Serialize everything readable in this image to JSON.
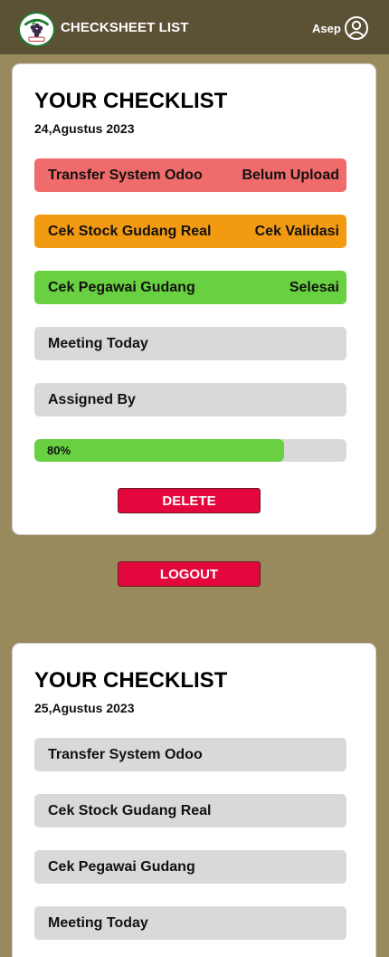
{
  "header": {
    "title": "CHECKSHEET LIST",
    "user_name": "Asep",
    "logo_icon": "grape-logo-icon",
    "user_icon": "user-circle-icon"
  },
  "colors": {
    "header_bg": "#5b5135",
    "page_bg": "#988a5c",
    "status_red": "#f06b6b",
    "status_orange": "#f29a12",
    "status_green": "#69d041",
    "item_gray": "#d9d9d9",
    "button_red": "#e4073e"
  },
  "checklists": [
    {
      "title": "YOUR CHECKLIST",
      "date": "24,Agustus 2023",
      "items": [
        {
          "label": "Transfer System Odoo",
          "status": "Belum Upload",
          "color": "#f06b6b"
        },
        {
          "label": "Cek Stock Gudang Real",
          "status": "Cek Validasi",
          "color": "#f29a12"
        },
        {
          "label": "Cek Pegawai Gudang",
          "status": "Selesai",
          "color": "#69d041"
        },
        {
          "label": "Meeting Today",
          "status": "",
          "color": "#d9d9d9"
        },
        {
          "label": "Assigned By",
          "status": "",
          "color": "#d9d9d9"
        }
      ],
      "progress": {
        "value": 0.8,
        "label": "80%"
      },
      "delete_label": "DELETE"
    },
    {
      "title": "YOUR CHECKLIST",
      "date": "25,Agustus 2023",
      "items": [
        {
          "label": "Transfer System Odoo",
          "status": "",
          "color": "#d9d9d9"
        },
        {
          "label": "Cek Stock Gudang Real",
          "status": "",
          "color": "#d9d9d9"
        },
        {
          "label": "Cek Pegawai Gudang",
          "status": "",
          "color": "#d9d9d9"
        },
        {
          "label": "Meeting Today",
          "status": "",
          "color": "#d9d9d9"
        }
      ]
    }
  ],
  "logout_label": "LOGOUT"
}
